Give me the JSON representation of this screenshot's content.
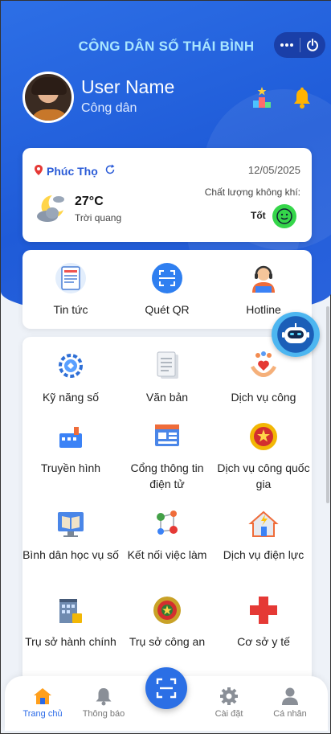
{
  "header": {
    "app_title": "CÔNG DÂN SỐ THÁI BÌNH",
    "more_icon": "more-horizontal-icon",
    "power_icon": "power-icon"
  },
  "user": {
    "name": "User Name",
    "role": "Công dân"
  },
  "weather": {
    "location": "Phúc Thọ",
    "date": "12/05/2025",
    "temperature": "27°C",
    "condition": "Trời quang",
    "air_quality_label": "Chất lượng không khí:",
    "air_quality_value": "Tốt"
  },
  "quick_actions": [
    {
      "label": "Tin tức",
      "icon": "news-icon"
    },
    {
      "label": "Quét QR",
      "icon": "qr-scan-icon"
    },
    {
      "label": "Hotline",
      "icon": "hotline-icon"
    }
  ],
  "services": [
    {
      "label": "Kỹ năng số",
      "icon": "digital-skills-icon"
    },
    {
      "label": "Văn bản",
      "icon": "document-icon"
    },
    {
      "label": "Dịch vụ công",
      "icon": "public-service-icon"
    },
    {
      "label": "Truyền hình",
      "icon": "television-icon"
    },
    {
      "label": "Cổng thông tin điện tử",
      "icon": "portal-icon"
    },
    {
      "label": "Dịch vụ công quốc gia",
      "icon": "national-emblem-icon"
    },
    {
      "label": "Bình dân học vụ số",
      "icon": "learning-icon"
    },
    {
      "label": "Kết nối việc làm",
      "icon": "job-network-icon"
    },
    {
      "label": "Dịch vụ điện lực",
      "icon": "electricity-icon"
    },
    {
      "label": "Trụ sở hành chính",
      "icon": "admin-office-icon"
    },
    {
      "label": "Trụ sở công an",
      "icon": "police-badge-icon"
    },
    {
      "label": "Cơ sở y tế",
      "icon": "medical-cross-icon"
    }
  ],
  "bottom_nav": [
    {
      "label": "Trang chủ",
      "icon": "home-icon"
    },
    {
      "label": "Thông báo",
      "icon": "bell-icon"
    },
    {
      "label": "Cài đặt",
      "icon": "gear-icon"
    },
    {
      "label": "Cá nhân",
      "icon": "person-icon"
    }
  ],
  "colors": {
    "primary": "#2a6ae8",
    "title": "#a9e6ff",
    "air_good": "#35d64a"
  }
}
